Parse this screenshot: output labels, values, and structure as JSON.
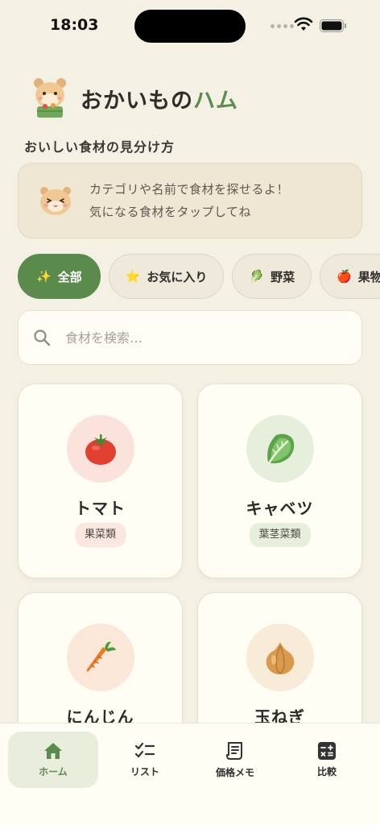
{
  "status": {
    "time": "18:03"
  },
  "header": {
    "title_main": "おかいもの",
    "title_accent": "ハム",
    "subtitle": "おいしい食材の見分け方"
  },
  "tip": {
    "line1": "カテゴリや名前で食材を探せるよ！",
    "line2": "気になる食材をタップしてね"
  },
  "chips": [
    {
      "icon": "✨",
      "label": "全部",
      "active": true
    },
    {
      "icon": "⭐",
      "label": "お気に入り",
      "active": false
    },
    {
      "icon": "🥬",
      "label": "野菜",
      "active": false
    },
    {
      "icon": "🍎",
      "label": "果物",
      "active": false
    }
  ],
  "search": {
    "placeholder": "食材を検索…"
  },
  "items": [
    {
      "name": "トマト",
      "tag": "果菜類",
      "emoji": "🍅",
      "circle_color": "#fbe3dc",
      "tag_color": "#fbe6e0"
    },
    {
      "name": "キャベツ",
      "tag": "葉茎菜類",
      "emoji": "🥬",
      "circle_color": "#e6efdc",
      "tag_color": "#e6efdc"
    },
    {
      "name": "にんじん",
      "tag": "",
      "emoji": "🥕",
      "circle_color": "#fbe7d8",
      "tag_color": ""
    },
    {
      "name": "玉ねぎ",
      "tag": "",
      "emoji": "🧅",
      "circle_color": "#f8ecd9",
      "tag_color": ""
    }
  ],
  "nav": [
    {
      "label": "ホーム",
      "icon": "home-icon",
      "active": true
    },
    {
      "label": "リスト",
      "icon": "checklist-icon",
      "active": false
    },
    {
      "label": "価格メモ",
      "icon": "receipt-icon",
      "active": false
    },
    {
      "label": "比較",
      "icon": "calculator-icon",
      "active": false
    }
  ],
  "colors": {
    "accent": "#5b8a4d",
    "background": "#f5f0e4",
    "card": "#fffdf4"
  }
}
